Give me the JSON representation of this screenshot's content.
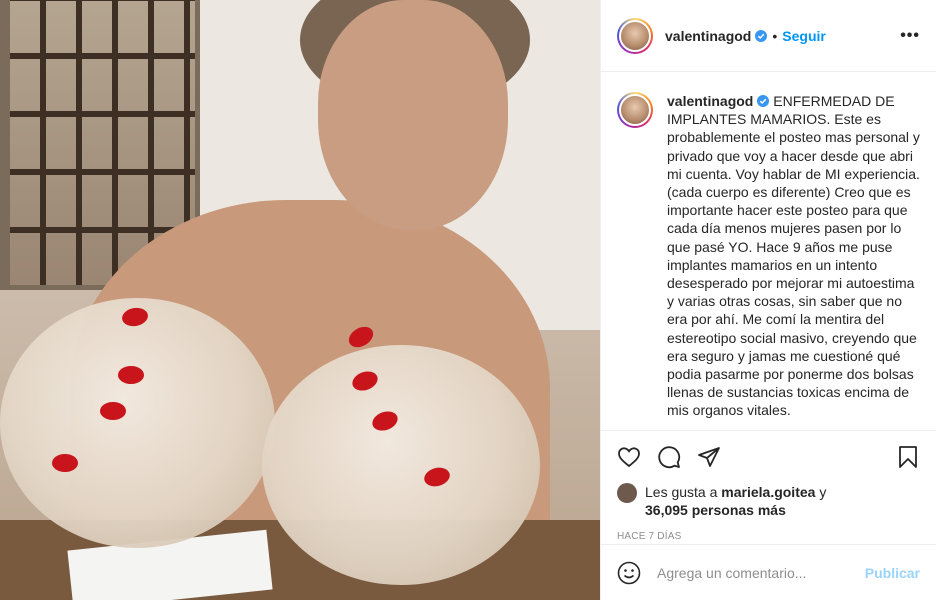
{
  "post": {
    "username": "valentinagod",
    "follow_label": "Seguir",
    "separator": "•",
    "more_label": "•••"
  },
  "caption": {
    "username": "valentinagod",
    "text": "ENFERMEDAD DE IMPLANTES MAMARIOS. Este es probablemente el posteo mas personal y privado que voy a hacer desde que abri mi cuenta. Voy hablar de MI experiencia. (cada cuerpo es diferente) Creo que es importante hacer este posteo para que cada día menos mujeres pasen por lo que pasé YO. Hace 9 años me puse implantes mamarios en un intento desesperado por mejorar mi autoestima y varias otras cosas, sin saber que no era por ahí. Me comí la mentira del estereotipo social masivo, creyendo que era seguro y jamas me cuestioné qué podia pasarme por ponerme dos bolsas llenas de sustancias toxicas encima de mis organos vitales."
  },
  "likes": {
    "prefix": "Les gusta a",
    "liker": "mariela.goitea",
    "conj": "y",
    "count_text": "36,095 personas más"
  },
  "time_ago": "HACE 7 DÍAS",
  "comment": {
    "placeholder": "Agrega un comentario...",
    "publish_label": "Publicar"
  },
  "icons": {
    "like": "heart-icon",
    "comment": "comment-icon",
    "share": "share-icon",
    "save": "bookmark-icon",
    "emoji": "emoji-icon",
    "verified": "verified-badge-icon"
  },
  "colors": {
    "accent": "#0095f6",
    "text": "#262626",
    "muted": "#8e8e8e",
    "verified": "#3897f0"
  }
}
